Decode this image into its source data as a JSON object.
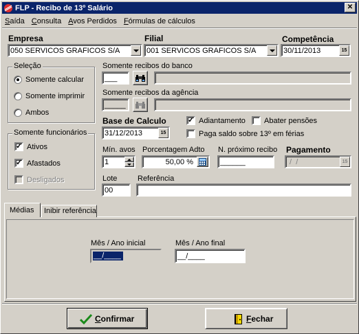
{
  "window": {
    "title": "FLP - Recibo de 13º Salário",
    "close_glyph": "✕"
  },
  "menu": [
    {
      "accel": "S",
      "rest": "aída"
    },
    {
      "accel": "C",
      "rest": "onsulta"
    },
    {
      "accel": "A",
      "rest": "vos Perdidos"
    },
    {
      "accel": "F",
      "rest": "órmulas de cálculos"
    }
  ],
  "empresa": {
    "label": "Empresa",
    "value": "050 SERVICOS GRAFICOS S/A"
  },
  "filial": {
    "label": "Filial",
    "value": "001 SERVICOS GRAFICOS S/A"
  },
  "competencia": {
    "label": "Competência",
    "value": "30/11/2013"
  },
  "selecao": {
    "label": "Seleção",
    "options": [
      "Somente calcular",
      "Somente imprimir",
      "Ambos"
    ],
    "selected": 0
  },
  "funcionarios": {
    "label": "Somente funcionários",
    "options": [
      {
        "label": "Ativos",
        "checked": true,
        "enabled": true
      },
      {
        "label": "Afastados",
        "checked": true,
        "enabled": true
      },
      {
        "label": "Desligados",
        "checked": false,
        "enabled": false
      }
    ]
  },
  "banco": {
    "label": "Somente recibos do banco",
    "code": "___",
    "name": ""
  },
  "agencia": {
    "label": "Somente recibos da agência",
    "code": "_____",
    "name": ""
  },
  "base": {
    "label": "Base de Calculo",
    "value": "31/12/2013"
  },
  "adiantamento": {
    "label": "Adiantamento",
    "checked": true
  },
  "abater": {
    "label": "Abater pensões",
    "checked": false
  },
  "paga_saldo": {
    "label": "Paga saldo sobre 13º em férias",
    "checked": false
  },
  "min_avos": {
    "label": "Mín. avos",
    "value": "1"
  },
  "porcentagem": {
    "label": "Porcentagem Adto",
    "value": "50,00 %"
  },
  "proximo": {
    "label": "N. próximo recibo",
    "value": "______"
  },
  "pagamento": {
    "label": "Pagamento",
    "value": " /  /"
  },
  "lote": {
    "label": "Lote",
    "value": "00"
  },
  "referencia": {
    "label": "Referência",
    "value": ""
  },
  "tabs": [
    "Médias",
    "Inibir referência"
  ],
  "medias": {
    "inicial_label": "Mês / Ano inicial",
    "inicial_value": "__/____",
    "final_label": "Mês / Ano final",
    "final_value": "__/____"
  },
  "buttons": {
    "confirmar": {
      "accel": "C",
      "rest": "onfirmar"
    },
    "fechar": {
      "accel": "F",
      "rest": "echar"
    }
  },
  "colors": {
    "title_bg": "#0a246a",
    "face": "#d4d0c8",
    "selection": "#0a246a"
  }
}
